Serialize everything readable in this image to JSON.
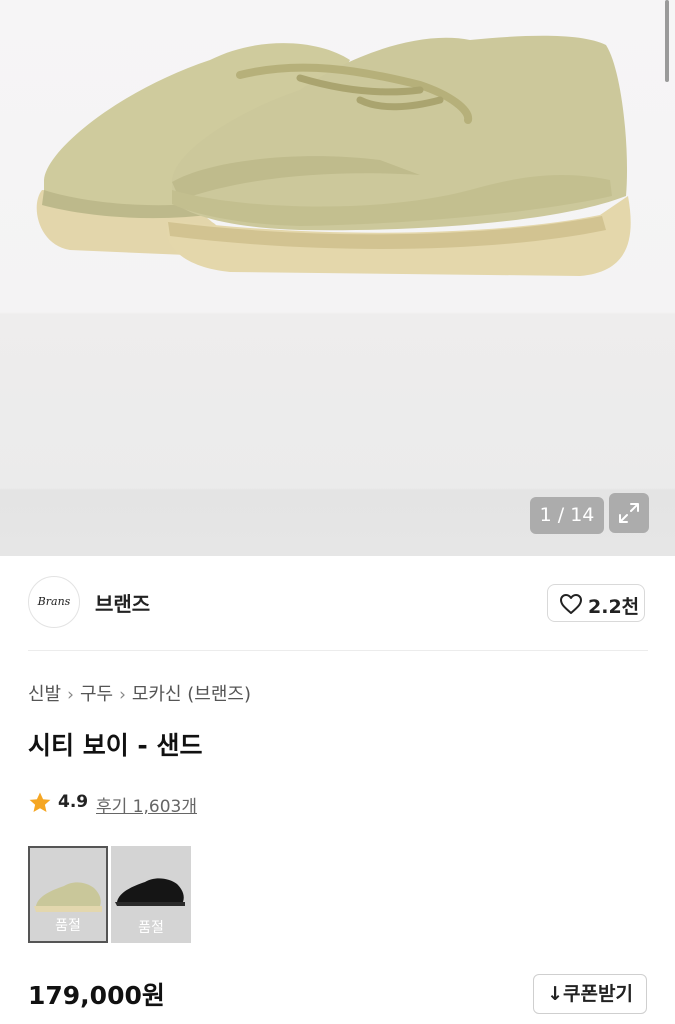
{
  "gallery": {
    "counter": "1 / 14",
    "expand_icon": "expand-arrows-icon"
  },
  "brand": {
    "logo_text": "Brans",
    "name": "브랜즈",
    "like_icon": "heart-outline-icon",
    "likes": "2.2천"
  },
  "breadcrumb": [
    "신발",
    "구두",
    "모카신 (브랜즈)"
  ],
  "product": {
    "title": "시티 보이 - 샌드",
    "rating": "4.9",
    "reviews": "후기 1,603개",
    "price": "179,000원"
  },
  "options": [
    {
      "status": "품절",
      "color": "#c9c79a",
      "selected": true
    },
    {
      "status": "품절",
      "color": "#151515",
      "selected": false
    }
  ],
  "coupon": {
    "icon": "download-icon",
    "label": "↓쿠폰받기"
  },
  "colors": {
    "shoe": "#cdc99d",
    "sole": "#e2d4a6",
    "star": "#f5a623"
  }
}
